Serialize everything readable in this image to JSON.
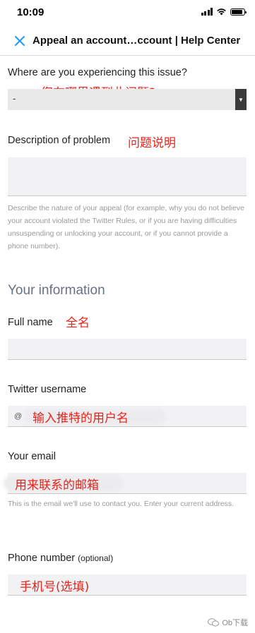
{
  "status_bar": {
    "time": "10:09"
  },
  "nav": {
    "title": "Appeal an account…ccount | Help Center"
  },
  "form": {
    "issue_location": {
      "label": "Where are you experiencing this issue?",
      "annotation": "您在哪里遇到此问题?",
      "selected": "-"
    },
    "description": {
      "label": "Description of problem",
      "annotation": "问题说明",
      "help": "Describe the nature of your appeal (for example, why you do not believe your account violated the Twitter Rules, or if you are having difficulties unsuspending or unlocking your account, or if you cannot provide a phone number)."
    },
    "your_information_heading": "Your information",
    "full_name": {
      "label": "Full name",
      "annotation": "全名"
    },
    "twitter_username": {
      "label": "Twitter username",
      "prefix": "@",
      "annotation": "输入推特的用户名"
    },
    "your_email": {
      "label": "Your email",
      "annotation": "用来联系的邮箱",
      "help": "This is the email we'll use to contact you. Enter your current address."
    },
    "phone_number": {
      "label": "Phone number",
      "optional": "(optional)",
      "annotation": "手机号(选填)"
    }
  },
  "watermark": {
    "text": "Ob下载"
  },
  "colors": {
    "annotation": "#e8231a",
    "close_icon": "#1d9bf0",
    "section_heading": "#667086"
  }
}
